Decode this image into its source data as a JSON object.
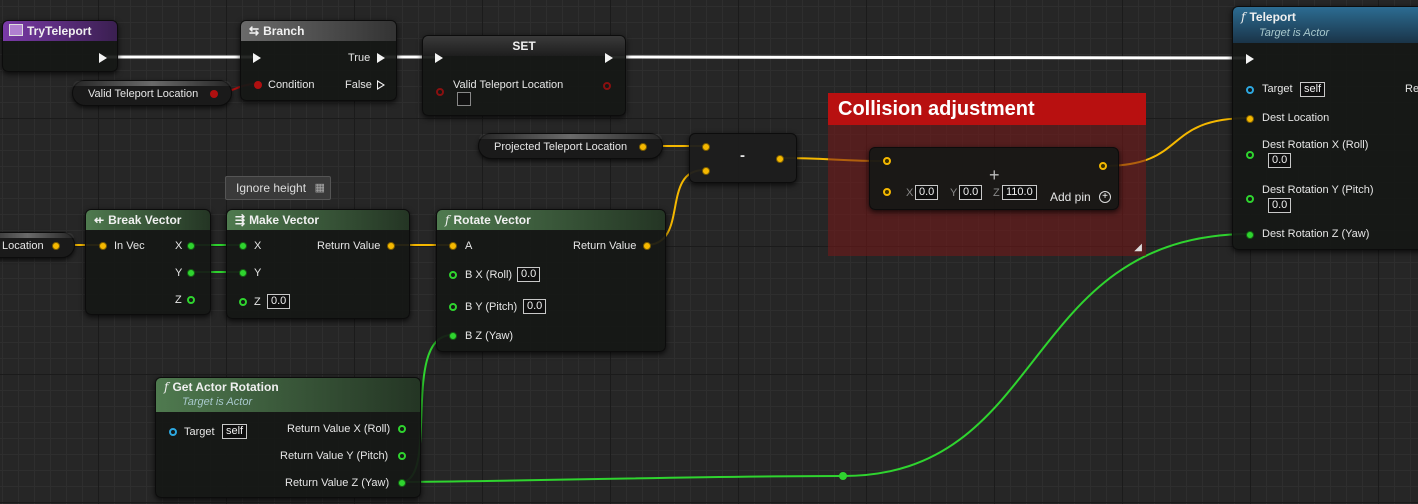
{
  "nodes": {
    "try_teleport": {
      "title": "TryTeleport"
    },
    "branch": {
      "title": "Branch",
      "condition": "Condition",
      "true_label": "True",
      "false_label": "False"
    },
    "set": {
      "title": "SET",
      "var_label": "Valid Teleport Location"
    },
    "valid_teleport_getter": {
      "label": "Valid Teleport Location"
    },
    "projected_getter": {
      "label": "Projected Teleport Location"
    },
    "subtract": {
      "op": "-"
    },
    "location_getter": {
      "label": "Location"
    },
    "break_vector": {
      "title": "Break Vector",
      "in": "In Vec",
      "x": "X",
      "y": "Y",
      "z": "Z"
    },
    "comment_ignore_height": {
      "text": "Ignore height"
    },
    "make_vector": {
      "title": "Make Vector",
      "x": "X",
      "y": "Y",
      "z": "Z",
      "z_value": "0.0",
      "return": "Return Value"
    },
    "rotate_vector": {
      "title": "Rotate Vector",
      "a": "A",
      "bx": "B X (Roll)",
      "bx_value": "0.0",
      "by": "B Y (Pitch)",
      "by_value": "0.0",
      "bz": "B Z (Yaw)",
      "return": "Return Value"
    },
    "comment_collision": {
      "text": "Collision adjustment"
    },
    "add_node": {
      "x_label": "X",
      "x": "0.0",
      "y_label": "Y",
      "y": "0.0",
      "z_label": "Z",
      "z": "110.0",
      "add_pin": "Add pin"
    },
    "get_actor_rotation": {
      "title": "Get Actor Rotation",
      "subtitle": "Target is Actor",
      "target": "Target",
      "target_value": "self",
      "rx": "Return Value X (Roll)",
      "ry": "Return Value Y (Pitch)",
      "rz": "Return Value Z (Yaw)"
    },
    "teleport": {
      "title": "Teleport",
      "subtitle": "Target is Actor",
      "target": "Target",
      "target_value": "self",
      "dest_location": "Dest Location",
      "rot_x": "Dest Rotation X (Roll)",
      "rot_x_value": "0.0",
      "rot_y": "Dest Rotation Y (Pitch)",
      "rot_y_value": "0.0",
      "rot_z": "Dest Rotation Z (Yaw)",
      "ret": "Ret"
    }
  },
  "colors": {
    "event_header": "#5b2a80",
    "flow_header": "#5a5a5a",
    "pure_header": "#3f6a3f",
    "function_header": "#2a5a78",
    "comment_bg": "#7a1818",
    "comment_title_bg": "#b81010",
    "exec_wire": "#ffffff",
    "vector_wire": "#f5b800",
    "float_wire": "#2fd42f",
    "bool_wire": "#b01010"
  },
  "icons": {
    "event": "event-icon",
    "branch": "branch-icon",
    "function": "function-f-icon",
    "break": "break-struct-icon",
    "make": "make-struct-icon",
    "add_pin": "plus-circle-icon"
  }
}
